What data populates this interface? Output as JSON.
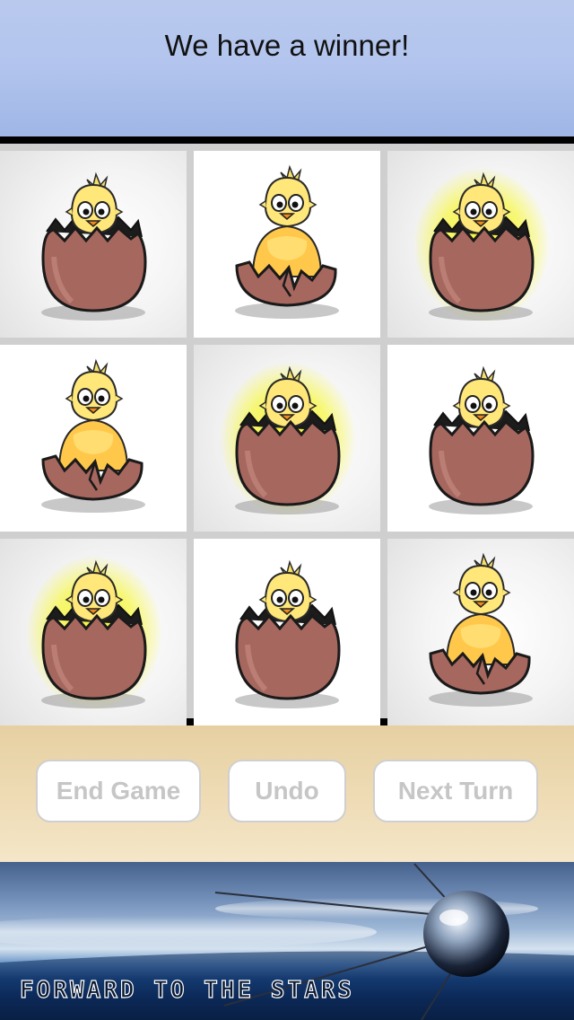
{
  "header": {
    "title": "We have a winner!"
  },
  "board": {
    "cells": [
      {
        "row": 0,
        "col": 0,
        "piece": "egg",
        "winning": false,
        "icon": "egg-chick-peeking-icon"
      },
      {
        "row": 0,
        "col": 1,
        "piece": "hatched",
        "winning": false,
        "icon": "hatched-chick-icon"
      },
      {
        "row": 0,
        "col": 2,
        "piece": "egg",
        "winning": true,
        "icon": "egg-chick-peeking-icon"
      },
      {
        "row": 1,
        "col": 0,
        "piece": "hatched",
        "winning": false,
        "icon": "hatched-chick-icon"
      },
      {
        "row": 1,
        "col": 1,
        "piece": "egg",
        "winning": true,
        "icon": "egg-chick-peeking-icon"
      },
      {
        "row": 1,
        "col": 2,
        "piece": "egg",
        "winning": false,
        "icon": "egg-chick-peeking-icon"
      },
      {
        "row": 2,
        "col": 0,
        "piece": "egg",
        "winning": true,
        "icon": "egg-chick-peeking-icon"
      },
      {
        "row": 2,
        "col": 1,
        "piece": "egg",
        "winning": false,
        "icon": "egg-chick-peeking-icon"
      },
      {
        "row": 2,
        "col": 2,
        "piece": "hatched",
        "winning": false,
        "icon": "hatched-chick-icon"
      }
    ]
  },
  "controls": {
    "end_game_label": "End Game",
    "undo_label": "Undo",
    "next_turn_label": "Next Turn"
  },
  "banner": {
    "tagline": "Forward to the stars"
  },
  "colors": {
    "header": "#b3c5ee",
    "winning_glow": "#f6f628",
    "egg_shell": "#a6675e",
    "chick": "#ffd94a",
    "button_text_disabled": "#c6c6c6"
  }
}
